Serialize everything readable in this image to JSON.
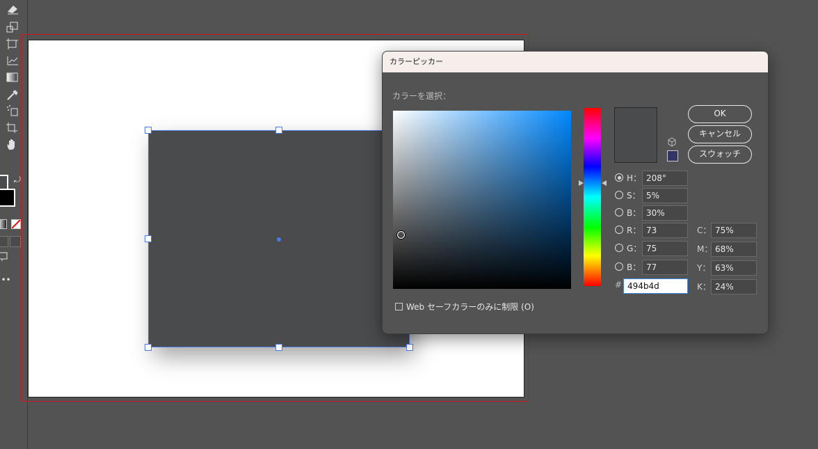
{
  "dialog": {
    "title": "カラーピッカー",
    "select_label": "カラーを選択：",
    "buttons": {
      "ok": "OK",
      "cancel": "キャンセル",
      "swatches": "スウォッチ"
    },
    "hsb": [
      {
        "label": "H：",
        "value": "208°"
      },
      {
        "label": "S：",
        "value": "5%"
      },
      {
        "label": "B：",
        "value": "30%"
      }
    ],
    "rgb": [
      {
        "label": "R：",
        "value": "73"
      },
      {
        "label": "G：",
        "value": "75"
      },
      {
        "label": "B：",
        "value": "77"
      }
    ],
    "cmyk": [
      {
        "label": "C：",
        "value": "75%"
      },
      {
        "label": "M：",
        "value": "68%"
      },
      {
        "label": "Y：",
        "value": "63%"
      },
      {
        "label": "K：",
        "value": "24%"
      }
    ],
    "hex_label": "#",
    "hex_value": "494b4d",
    "websafe_label": "Web セーフカラーのみに制限 (O)",
    "current_color": "#494b4d",
    "hue_degrees": 208
  },
  "canvas": {
    "rect_fill": "#494b4d",
    "selection_color": "#4d79e6",
    "bleed_color": "#d0161b"
  },
  "toolbar": {
    "icons": [
      "eraser-icon",
      "scale-icon",
      "artboard-icon",
      "graph-icon",
      "gradient-icon",
      "eyedropper-icon",
      "symbol-sprayer-icon",
      "slice-icon",
      "hand-icon",
      "swap-colors-icon",
      "none-color-icon",
      "draw-mode-icon",
      "screen-mode-icon",
      "more-tools-icon"
    ]
  }
}
